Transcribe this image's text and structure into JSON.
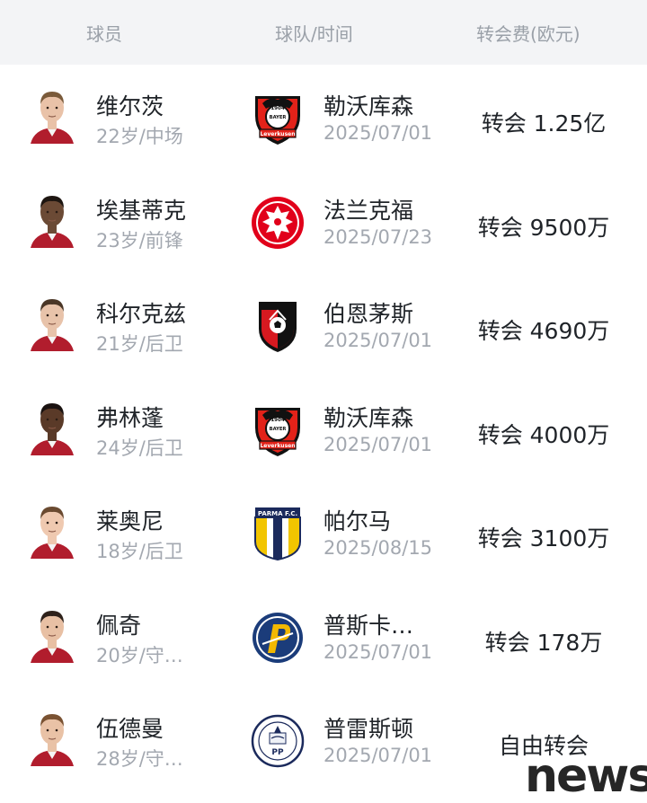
{
  "header": {
    "player": "球员",
    "team_time": "球队/时间",
    "fee": "转会费(欧元)"
  },
  "rows": [
    {
      "name": "维尔茨",
      "meta": "22岁/中场",
      "team": "勒沃库森",
      "date": "2025/07/01",
      "fee": "转会 1.25亿",
      "logo": "leverkusen-logo",
      "skin": "#e9c2a8",
      "hair": "#7a5a3a"
    },
    {
      "name": "埃基蒂克",
      "meta": "23岁/前锋",
      "team": "法兰克福",
      "date": "2025/07/23",
      "fee": "转会 9500万",
      "logo": "eintracht-frankfurt-logo",
      "skin": "#6b4a35",
      "hair": "#1e1611"
    },
    {
      "name": "科尔克兹",
      "meta": "21岁/后卫",
      "team": "伯恩茅斯",
      "date": "2025/07/01",
      "fee": "转会 4690万",
      "logo": "bournemouth-logo",
      "skin": "#e8c3aa",
      "hair": "#4a3626"
    },
    {
      "name": "弗林蓬",
      "meta": "24岁/后卫",
      "team": "勒沃库森",
      "date": "2025/07/01",
      "fee": "转会 4000万",
      "logo": "leverkusen-logo",
      "skin": "#5a3a28",
      "hair": "#1a1210"
    },
    {
      "name": "莱奥尼",
      "meta": "18岁/后卫",
      "team": "帕尔马",
      "date": "2025/08/15",
      "fee": "转会 3100万",
      "logo": "parma-logo",
      "skin": "#efc9b0",
      "hair": "#6a4a30"
    },
    {
      "name": "佩奇",
      "meta": "20岁/守…",
      "team": "普斯卡…",
      "date": "2025/07/01",
      "fee": "转会 178万",
      "logo": "puskas-logo",
      "skin": "#e8c0a4",
      "hair": "#2e211a"
    },
    {
      "name": "伍德曼",
      "meta": "28岁/守…",
      "team": "普雷斯顿",
      "date": "2025/07/01",
      "fee": "自由转会",
      "logo": "preston-logo",
      "skin": "#e9c2a6",
      "hair": "#7a5232"
    }
  ],
  "logo_texts": {
    "leverkusen_top": "1904",
    "leverkusen_bayer": "BAYER",
    "leverkusen_bottom": "Leverkusen",
    "parma_top": "PARMA F.C.",
    "preston_initials": "PP"
  },
  "watermark": "news",
  "colors": {
    "header_bg": "#f3f4f6",
    "primary_text": "#1f2328",
    "secondary_text": "#a3a8b0",
    "header_text": "#9aa0a8"
  }
}
